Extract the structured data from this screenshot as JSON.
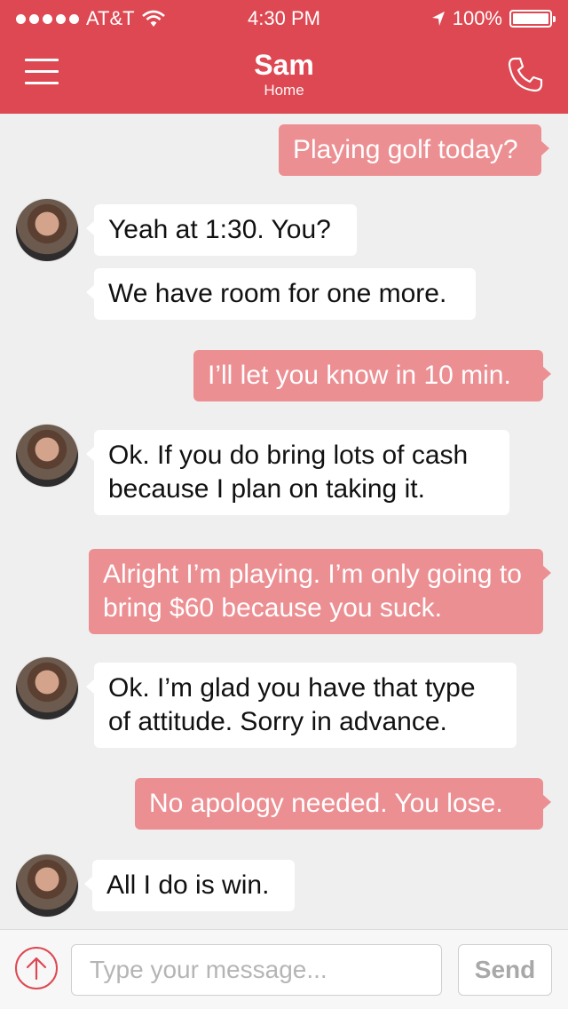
{
  "status_bar": {
    "carrier": "AT&T",
    "time": "4:30 PM",
    "battery": "100%"
  },
  "header": {
    "title": "Sam",
    "subtitle": "Home",
    "menu_icon": "hamburger-icon",
    "call_icon": "phone-icon"
  },
  "messages": [
    {
      "direction": "out",
      "text": "Playing golf today?"
    },
    {
      "direction": "in",
      "text": "Yeah at 1:30. You?"
    },
    {
      "direction": "in",
      "text": "We have room for one more."
    },
    {
      "direction": "out",
      "text": "I’ll let you know in 10 min."
    },
    {
      "direction": "in",
      "text": "Ok. If you do bring lots of cash because I plan on taking it."
    },
    {
      "direction": "out",
      "text": "Alright I’m playing. I’m only going to bring $60 because you suck."
    },
    {
      "direction": "in",
      "text": "Ok. I’m glad you have that type of attitude. Sorry in advance."
    },
    {
      "direction": "out",
      "text": "No apology needed. You lose."
    },
    {
      "direction": "in",
      "text": "All I do is win."
    }
  ],
  "composer": {
    "placeholder": "Type your message...",
    "send_label": "Send",
    "attach_icon": "arrow-up-circle-icon"
  },
  "colors": {
    "accent": "#dd4852",
    "outgoing_bubble": "#ec8f93",
    "incoming_bubble": "#ffffff",
    "background": "#efeff0"
  }
}
